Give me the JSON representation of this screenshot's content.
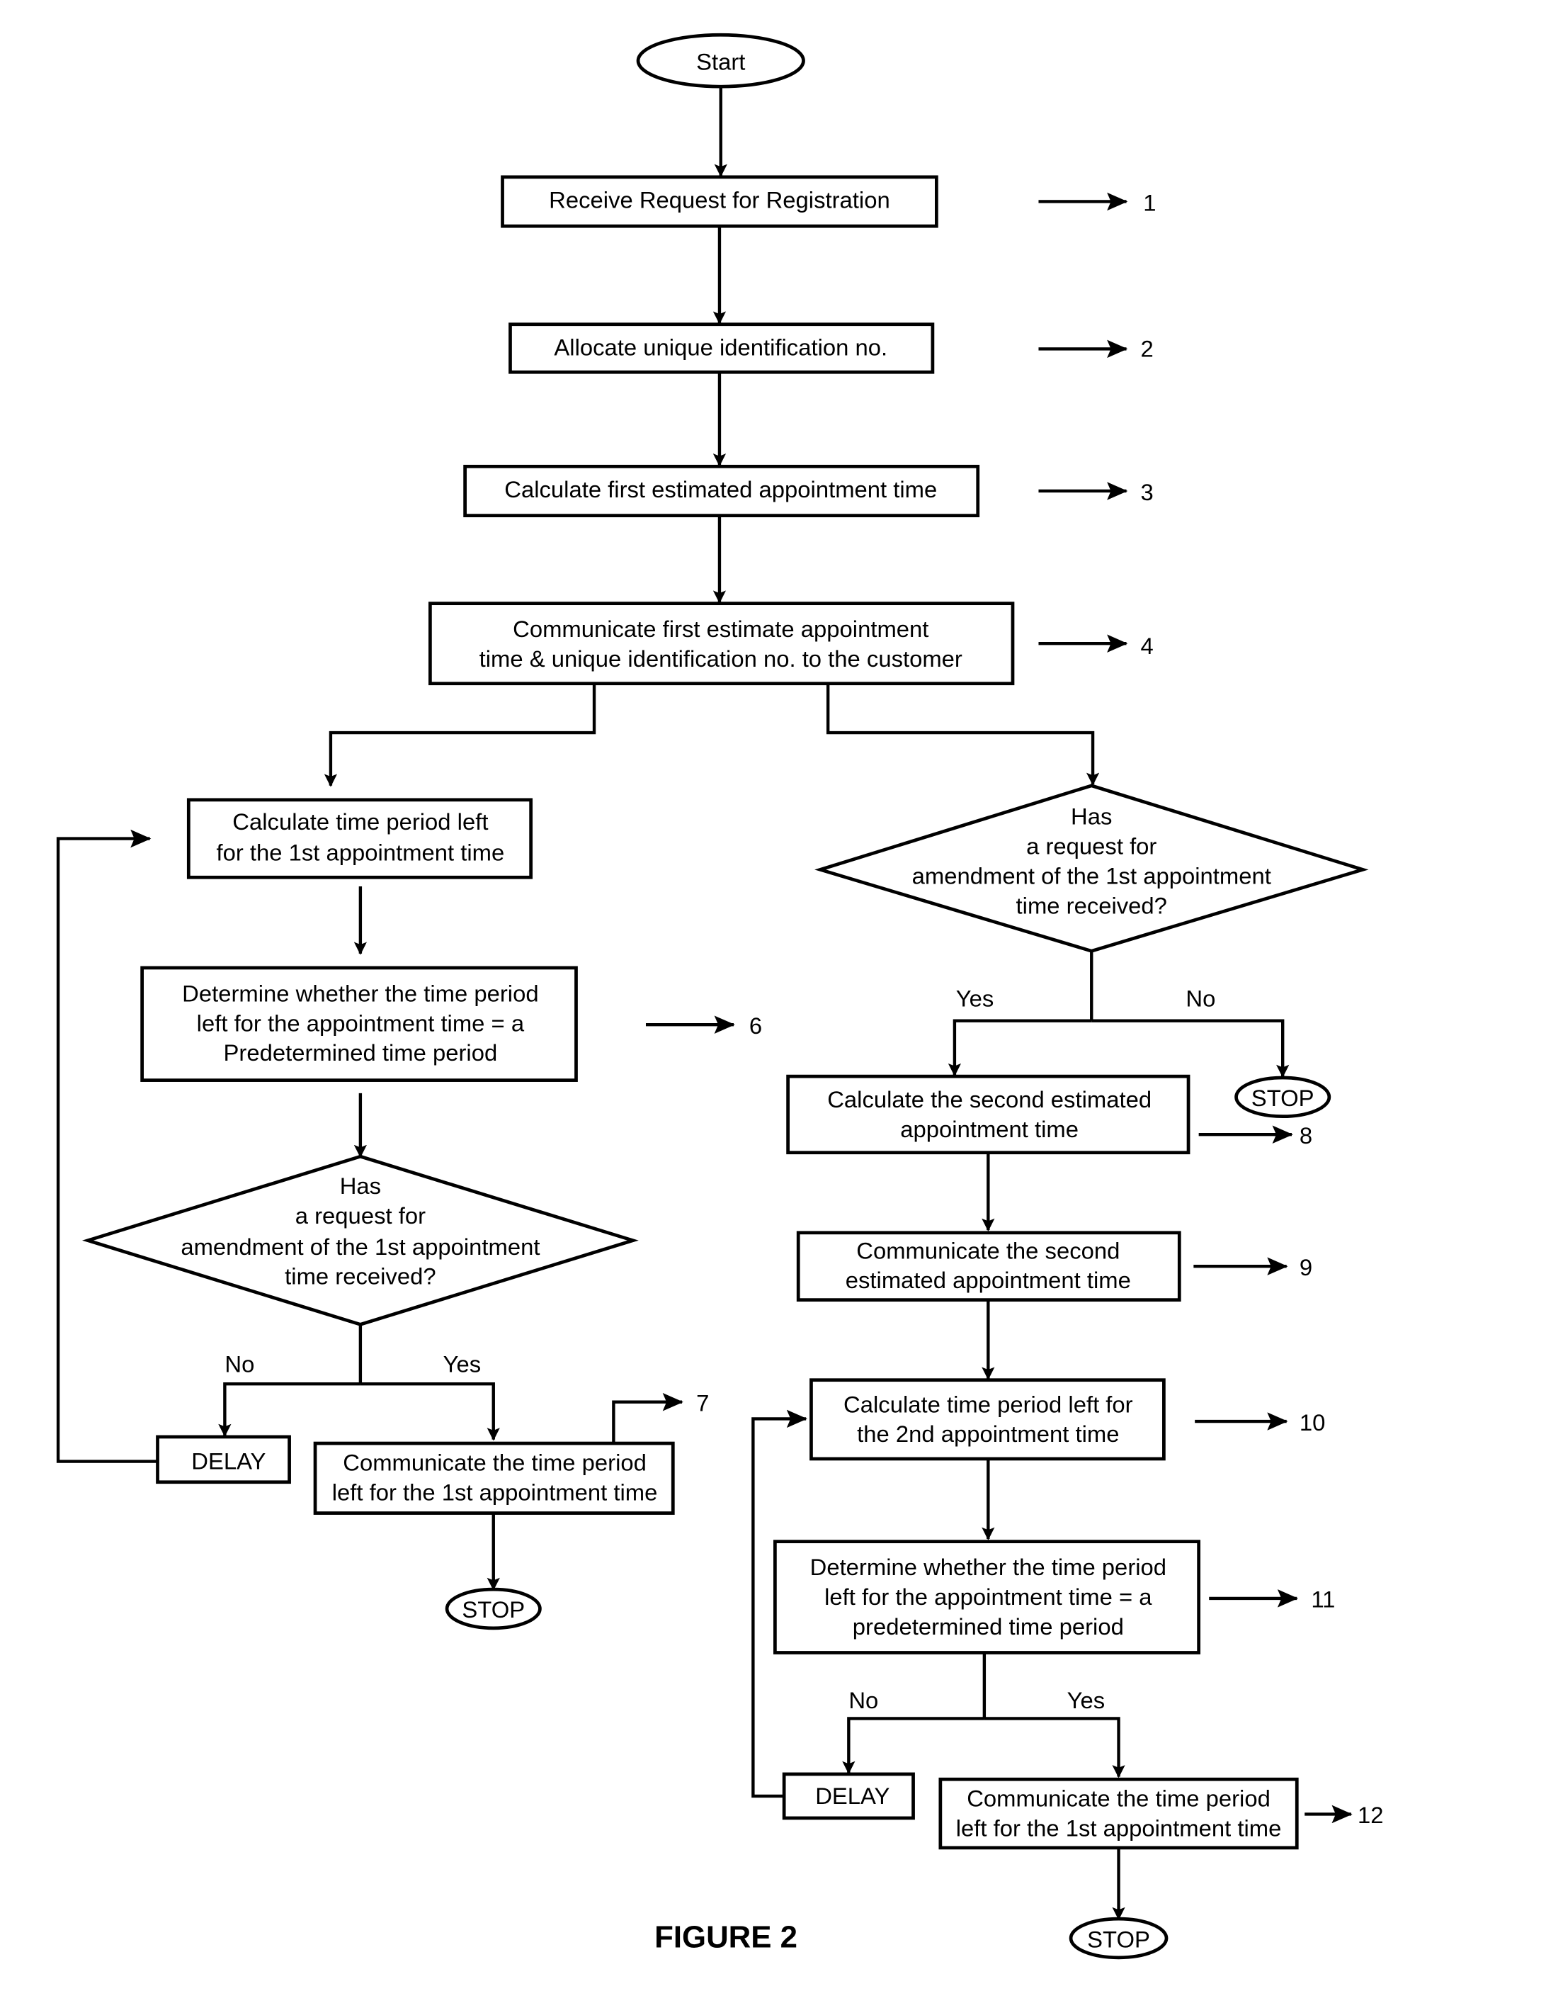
{
  "figure": {
    "caption": "FIGURE 2",
    "start": "Start",
    "stop": "STOP",
    "delay": "DELAY",
    "steps": {
      "s1": [
        "Receive Request for Registration"
      ],
      "s2": [
        "Allocate unique identification no."
      ],
      "s3": [
        "Calculate first estimated appointment time"
      ],
      "s4": [
        "Communicate first estimate appointment",
        "time & unique identification no. to the customer"
      ],
      "s5": [
        "Calculate time period left",
        "for the 1st appointment time"
      ],
      "s6": [
        "Determine whether the time period",
        "left for the appointment time = a",
        "Predetermined time period"
      ],
      "d1": [
        "Has",
        "a request for",
        "amendment of the 1st appointment",
        "time received?"
      ],
      "s7": [
        "Communicate the time period",
        "left for the 1st appointment time"
      ],
      "d2": [
        "Has",
        "a request for",
        "amendment of the 1st appointment",
        "time received?"
      ],
      "s8": [
        "Calculate the second estimated",
        "appointment time"
      ],
      "s9": [
        "Communicate the second",
        "estimated appointment time"
      ],
      "s10": [
        "Calculate time period left for",
        "the 2nd appointment time"
      ],
      "s11": [
        "Determine whether the time period",
        "left for the appointment time = a",
        "predetermined time period"
      ],
      "s12": [
        "Communicate the time period",
        "left for the 1st appointment time"
      ]
    },
    "branch_labels": {
      "yes": "Yes",
      "no": "No"
    },
    "reference_numbers": [
      "1",
      "2",
      "3",
      "4",
      "6",
      "7",
      "8",
      "9",
      "10",
      "11",
      "12"
    ]
  }
}
